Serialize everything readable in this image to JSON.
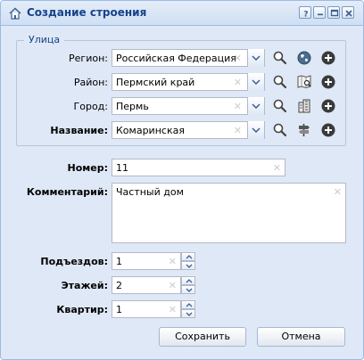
{
  "window": {
    "title": "Создание строения"
  },
  "street": {
    "legend": "Улица",
    "region": {
      "label": "Регион:",
      "value": "Российская Федерация"
    },
    "district": {
      "label": "Район:",
      "value": "Пермский край"
    },
    "city": {
      "label": "Город:",
      "value": "Пермь"
    },
    "name": {
      "label": "Название:",
      "value": "Комаринская"
    }
  },
  "form": {
    "number": {
      "label": "Номер:",
      "value": "11"
    },
    "comment": {
      "label": "Комментарий:",
      "value": "Частный дом"
    },
    "entrances": {
      "label": "Подъездов:",
      "value": "1"
    },
    "floors": {
      "label": "Этажей:",
      "value": "2"
    },
    "apartments": {
      "label": "Квартир:",
      "value": "1"
    }
  },
  "buttons": {
    "save": "Сохранить",
    "cancel": "Отмена"
  }
}
